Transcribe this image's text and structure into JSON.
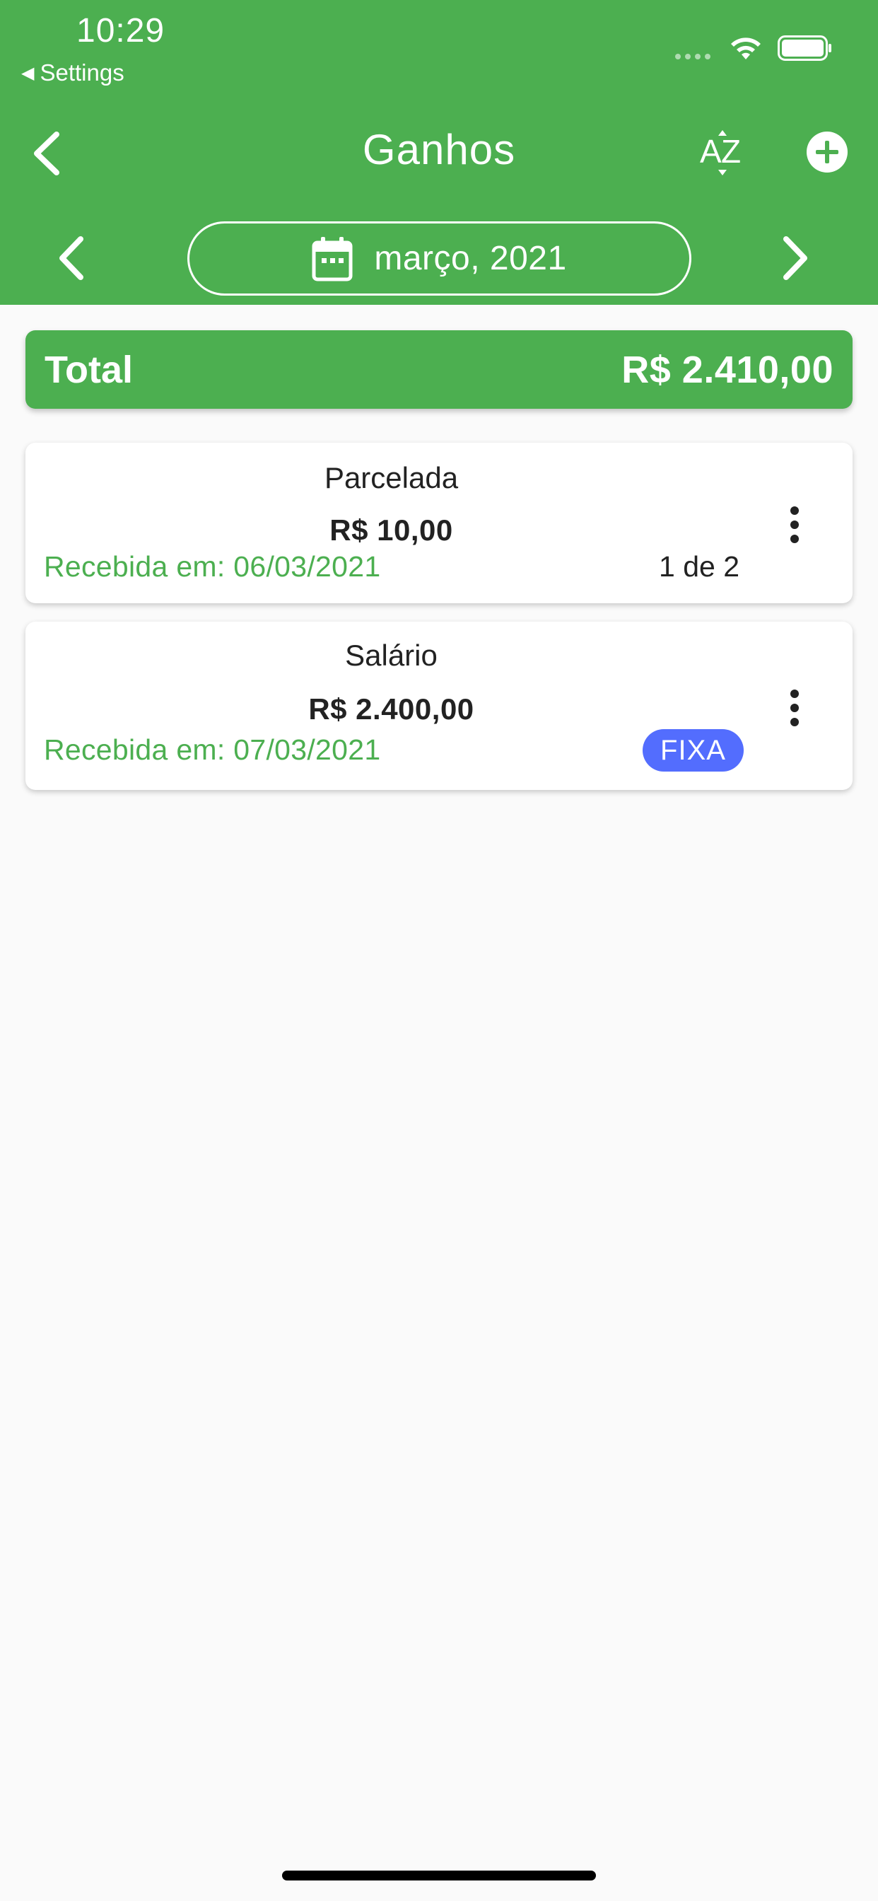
{
  "status_bar": {
    "time": "10:29",
    "back_app": "Settings"
  },
  "header": {
    "title": "Ganhos",
    "back_icon": "chevron-left-icon",
    "sort_icon": "sort-az-icon",
    "add_icon": "plus-circle-icon"
  },
  "month_selector": {
    "label": "março, 2021",
    "calendar_icon": "calendar-icon"
  },
  "total": {
    "label": "Total",
    "value": "R$ 2.410,00"
  },
  "items": [
    {
      "name": "Parcelada",
      "amount": "R$ 10,00",
      "received": "Recebida em: 06/03/2021",
      "installment": "1 de 2"
    },
    {
      "name": "Salário",
      "amount": "R$ 2.400,00",
      "received": "Recebida em: 07/03/2021",
      "badge": "FIXA"
    }
  ],
  "colors": {
    "primary": "#4caf50",
    "badge": "#536dfe",
    "background": "#fafafa"
  }
}
